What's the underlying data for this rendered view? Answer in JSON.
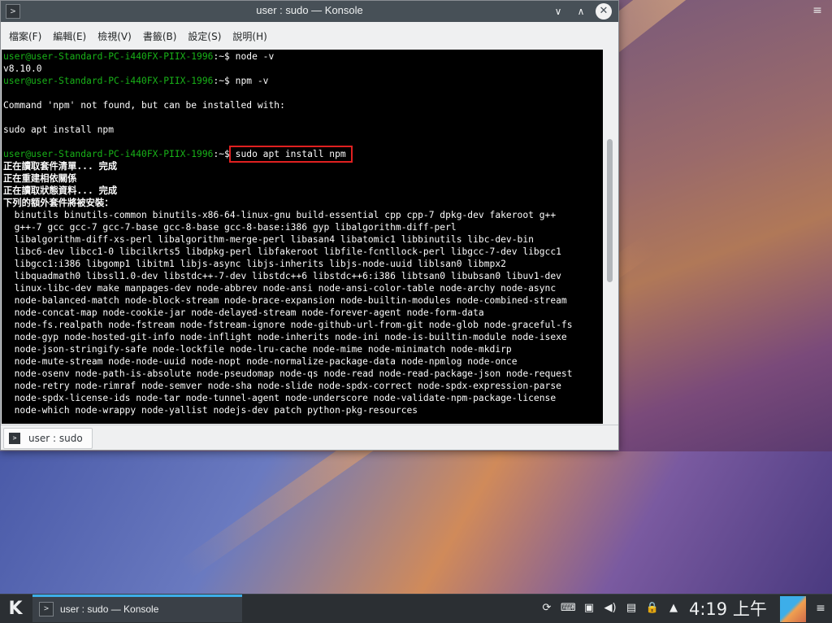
{
  "window": {
    "title": "user : sudo — Konsole",
    "app_icon": ">",
    "buttons": {
      "minimize": "∨",
      "maximize": "∧",
      "close": "✕"
    }
  },
  "menubar": {
    "items": [
      "檔案(F)",
      "編輯(E)",
      "檢視(V)",
      "書籤(B)",
      "設定(S)",
      "說明(H)"
    ]
  },
  "terminal": {
    "prompt_user": "user@user-Standard-PC-i440FX-PIIX-1996",
    "prompt_suffix": ":~$ ",
    "lines": [
      {
        "type": "prompt",
        "cmd": "node -v"
      },
      {
        "type": "out",
        "text": "v8.10.0"
      },
      {
        "type": "prompt",
        "cmd": "npm -v"
      },
      {
        "type": "out",
        "text": ""
      },
      {
        "type": "out",
        "text": "Command 'npm' not found, but can be installed with:"
      },
      {
        "type": "out",
        "text": ""
      },
      {
        "type": "out",
        "text": "sudo apt install npm"
      },
      {
        "type": "out",
        "text": ""
      },
      {
        "type": "prompt",
        "cmd": "sudo apt install npm",
        "highlight": true
      },
      {
        "type": "bold",
        "text": "正在讀取套件清單... 完成"
      },
      {
        "type": "bold",
        "text": "正在重建相依關係"
      },
      {
        "type": "bold",
        "text": "正在讀取狀態資料... 完成"
      },
      {
        "type": "bold",
        "text": "下列的額外套件將被安裝："
      },
      {
        "type": "out",
        "text": "  binutils binutils-common binutils-x86-64-linux-gnu build-essential cpp cpp-7 dpkg-dev fakeroot g++"
      },
      {
        "type": "out",
        "text": "  g++-7 gcc gcc-7 gcc-7-base gcc-8-base gcc-8-base:i386 gyp libalgorithm-diff-perl"
      },
      {
        "type": "out",
        "text": "  libalgorithm-diff-xs-perl libalgorithm-merge-perl libasan4 libatomic1 libbinutils libc-dev-bin"
      },
      {
        "type": "out",
        "text": "  libc6-dev libcc1-0 libcilkrts5 libdpkg-perl libfakeroot libfile-fcntllock-perl libgcc-7-dev libgcc1"
      },
      {
        "type": "out",
        "text": "  libgcc1:i386 libgomp1 libitm1 libjs-async libjs-inherits libjs-node-uuid liblsan0 libmpx2"
      },
      {
        "type": "out",
        "text": "  libquadmath0 libssl1.0-dev libstdc++-7-dev libstdc++6 libstdc++6:i386 libtsan0 libubsan0 libuv1-dev"
      },
      {
        "type": "out",
        "text": "  linux-libc-dev make manpages-dev node-abbrev node-ansi node-ansi-color-table node-archy node-async"
      },
      {
        "type": "out",
        "text": "  node-balanced-match node-block-stream node-brace-expansion node-builtin-modules node-combined-stream"
      },
      {
        "type": "out",
        "text": "  node-concat-map node-cookie-jar node-delayed-stream node-forever-agent node-form-data"
      },
      {
        "type": "out",
        "text": "  node-fs.realpath node-fstream node-fstream-ignore node-github-url-from-git node-glob node-graceful-fs"
      },
      {
        "type": "out",
        "text": "  node-gyp node-hosted-git-info node-inflight node-inherits node-ini node-is-builtin-module node-isexe"
      },
      {
        "type": "out",
        "text": "  node-json-stringify-safe node-lockfile node-lru-cache node-mime node-minimatch node-mkdirp"
      },
      {
        "type": "out",
        "text": "  node-mute-stream node-node-uuid node-nopt node-normalize-package-data node-npmlog node-once"
      },
      {
        "type": "out",
        "text": "  node-osenv node-path-is-absolute node-pseudomap node-qs node-read node-read-package-json node-request"
      },
      {
        "type": "out",
        "text": "  node-retry node-rimraf node-semver node-sha node-slide node-spdx-correct node-spdx-expression-parse"
      },
      {
        "type": "out",
        "text": "  node-spdx-license-ids node-tar node-tunnel-agent node-underscore node-validate-npm-package-license"
      },
      {
        "type": "out",
        "text": "  node-which node-wrappy node-yallist nodejs-dev patch python-pkg-resources"
      }
    ]
  },
  "tabbar": {
    "tab_label": "user : sudo",
    "tab_icon": ">"
  },
  "taskbar": {
    "launcher": "K",
    "task_label": "user : sudo — Konsole",
    "task_icon": ">",
    "tray_icons": [
      "update-icon",
      "keyboard-icon",
      "display-icon",
      "volume-icon",
      "clipboard-icon",
      "lock-icon",
      "expand-tray-icon"
    ],
    "tray_glyphs": [
      "⟳",
      "⌨",
      "▣",
      "◀)",
      "▤",
      "🔒",
      "▲"
    ],
    "clock": "4:19 上午",
    "panel_menu": "≡"
  },
  "desktop": {
    "menu_glyph": "≡"
  },
  "colors": {
    "prompt_green": "#18b218",
    "highlight_red": "#e02020",
    "accent_blue": "#3daee9"
  }
}
